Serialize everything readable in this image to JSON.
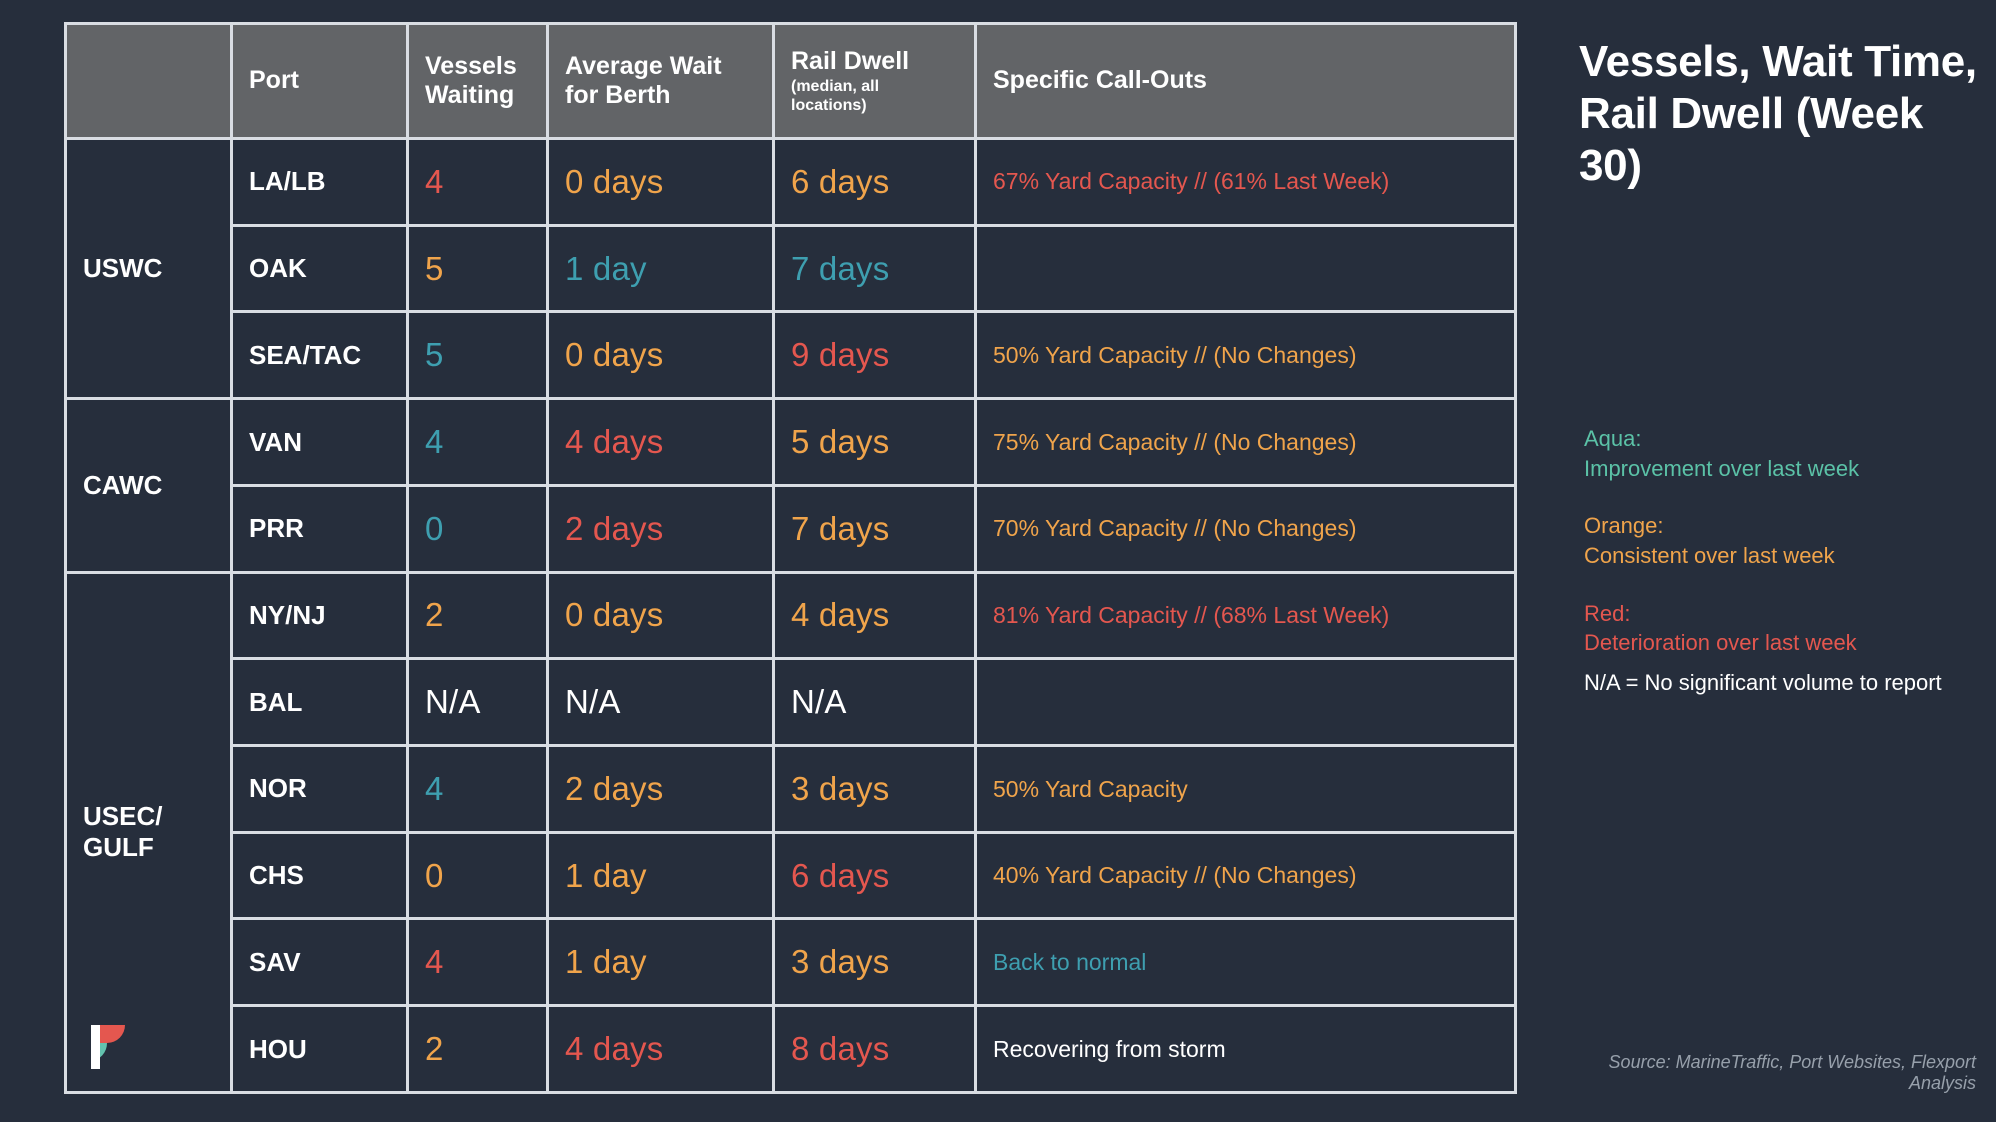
{
  "table": {
    "headers": {
      "group": "",
      "port": "Port",
      "vessels_waiting": "Vessels Waiting",
      "average_wait": "Average Wait for Berth",
      "rail_dwell": "Rail Dwell",
      "rail_dwell_sub": "(median, all locations)",
      "callouts": "Specific Call-Outs"
    },
    "groups": [
      {
        "label": "USWC",
        "rows": [
          {
            "port": "LA/LB",
            "vessels": "4",
            "vessels_color": "red",
            "wait": "0 days",
            "wait_color": "orange",
            "dwell": "6 days",
            "dwell_color": "orange",
            "callout": "67% Yard Capacity // (61% Last Week)",
            "callout_color": "red"
          },
          {
            "port": "OAK",
            "vessels": "5",
            "vessels_color": "orange",
            "wait": "1 day",
            "wait_color": "aqua",
            "dwell": "7 days",
            "dwell_color": "aqua",
            "callout": "",
            "callout_color": "white"
          },
          {
            "port": "SEA/TAC",
            "vessels": "5",
            "vessels_color": "aqua",
            "wait": "0 days",
            "wait_color": "orange",
            "dwell": "9 days",
            "dwell_color": "red",
            "callout": "50% Yard Capacity // (No Changes)",
            "callout_color": "orange"
          }
        ]
      },
      {
        "label": "CAWC",
        "rows": [
          {
            "port": "VAN",
            "vessels": "4",
            "vessels_color": "aqua",
            "wait": "4 days",
            "wait_color": "red",
            "dwell": "5 days",
            "dwell_color": "orange",
            "callout": "75% Yard Capacity // (No Changes)",
            "callout_color": "orange"
          },
          {
            "port": "PRR",
            "vessels": "0",
            "vessels_color": "aqua",
            "wait": "2 days",
            "wait_color": "red",
            "dwell": "7 days",
            "dwell_color": "orange",
            "callout": "70% Yard Capacity // (No Changes)",
            "callout_color": "orange"
          }
        ]
      },
      {
        "label": "USEC/ GULF",
        "rows": [
          {
            "port": "NY/NJ",
            "vessels": "2",
            "vessels_color": "orange",
            "wait": "0 days",
            "wait_color": "orange",
            "dwell": "4 days",
            "dwell_color": "orange",
            "callout": "81% Yard Capacity // (68% Last Week)",
            "callout_color": "red"
          },
          {
            "port": "BAL",
            "vessels": "N/A",
            "vessels_color": "white",
            "wait": "N/A",
            "wait_color": "white",
            "dwell": "N/A",
            "dwell_color": "white",
            "callout": "",
            "callout_color": "white"
          },
          {
            "port": "NOR",
            "vessels": "4",
            "vessels_color": "aqua",
            "wait": "2 days",
            "wait_color": "orange",
            "dwell": "3 days",
            "dwell_color": "orange",
            "callout": "50% Yard Capacity",
            "callout_color": "orange"
          },
          {
            "port": "CHS",
            "vessels": "0",
            "vessels_color": "orange",
            "wait": "1 day",
            "wait_color": "orange",
            "dwell": "6 days",
            "dwell_color": "red",
            "callout": "40% Yard Capacity // (No Changes)",
            "callout_color": "orange"
          },
          {
            "port": "SAV",
            "vessels": "4",
            "vessels_color": "red",
            "wait": "1 day",
            "wait_color": "orange",
            "dwell": "3 days",
            "dwell_color": "orange",
            "callout": "Back to normal",
            "callout_color": "aqua"
          },
          {
            "port": "HOU",
            "vessels": "2",
            "vessels_color": "orange",
            "wait": "4 days",
            "wait_color": "red",
            "dwell": "8 days",
            "dwell_color": "red",
            "callout": "Recovering from storm",
            "callout_color": "white"
          }
        ]
      }
    ]
  },
  "side": {
    "title": "Vessels, Wait Time, Rail Dwell (Week 30)",
    "legend": [
      {
        "key": "Aqua:",
        "desc": "Improvement over last week",
        "color_class": "lg-aqua"
      },
      {
        "key": "Orange:",
        "desc": "Consistent over last week",
        "color_class": "lg-orange"
      },
      {
        "key": "Red:",
        "desc": "Deterioration over last week",
        "color_class": "lg-red"
      }
    ],
    "na_note": "N/A = No significant volume to report",
    "source": "Source: MarineTraffic, Port Websites, Flexport Analysis"
  },
  "logo": {
    "name": "flexport-logo"
  },
  "colors": {
    "background": "#262e3c",
    "header_gray": "#626467",
    "gridline": "#d9dde3",
    "red": "#e4574f",
    "orange": "#f0a44b",
    "aqua": "#3e9fb0",
    "legend_aqua": "#5bc2a7",
    "white": "#ffffff",
    "source_gray": "#97a0ab"
  }
}
